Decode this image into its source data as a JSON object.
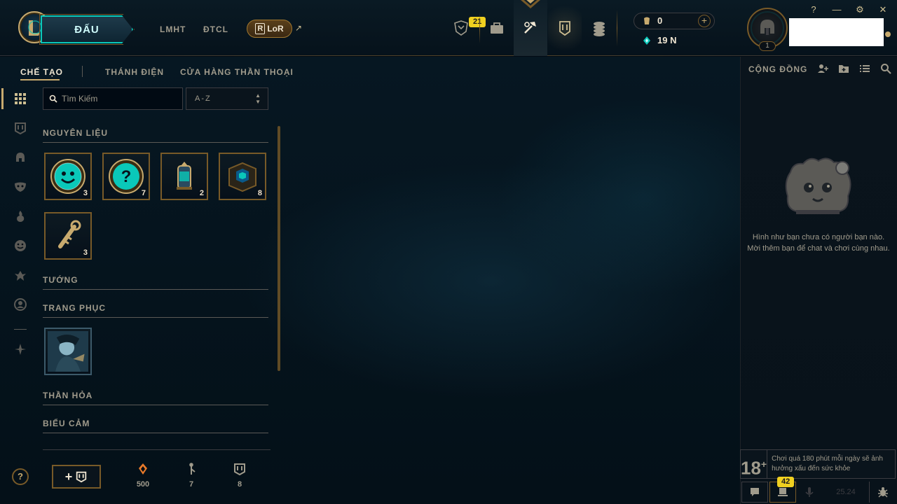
{
  "header": {
    "play_label": "ĐẤU",
    "nav_links": [
      "LMHT",
      "ĐTCL"
    ],
    "lor_label": "LoR",
    "lor_arrow": "↗",
    "missions_badge": "21",
    "currency_rp": "0",
    "currency_be": "19 N",
    "level": "1",
    "window_controls": {
      "help": "?",
      "minimize": "—",
      "settings": "⚙",
      "close": "✕"
    }
  },
  "subnav": {
    "tabs": [
      {
        "label": "CHẾ TẠO",
        "active": true
      },
      {
        "label": "THÁNH ĐIỆN",
        "active": false
      },
      {
        "label": "CỬA HÀNG THẦN THOẠI",
        "active": false
      }
    ]
  },
  "crafting": {
    "search_placeholder": "Tìm Kiếm",
    "sort_value": "A-Z",
    "categories": [
      {
        "label": "NGUYÊN LIỆU"
      },
      {
        "label": "TƯỚNG"
      },
      {
        "label": "TRANG PHỤC"
      },
      {
        "label": "THẦN HỎA"
      },
      {
        "label": "BIỂU CẢM"
      }
    ],
    "materials": [
      {
        "name": "emote-orb",
        "count": "3"
      },
      {
        "name": "mystery-orb",
        "count": "7"
      },
      {
        "name": "capsule",
        "count": "2"
      },
      {
        "name": "hextech-chest",
        "count": "8"
      },
      {
        "name": "key",
        "count": "3"
      }
    ]
  },
  "bottom": {
    "help": "?",
    "add_plus": "+",
    "stats": [
      {
        "icon": "orange-essence-icon",
        "value": "500"
      },
      {
        "icon": "key-fragment-icon",
        "value": "7"
      },
      {
        "icon": "chest-icon",
        "value": "8"
      }
    ]
  },
  "social": {
    "title": "CỘNG ĐỒNG",
    "empty_text": "Hình như bạn chưa có người bạn nào. Mời thêm bạn để chat và chơi cùng nhau.",
    "warning_age": "18",
    "warning_plus": "+",
    "warning_text": "Chơi quá 180 phút mỗi ngày sẽ ảnh hưởng xấu đến sức khỏe",
    "messages_badge": "42",
    "version": "25.24"
  },
  "colors": {
    "gold": "#c8aa6e",
    "gold_dark": "#785a28",
    "teal": "#0ac8b9",
    "text": "#a09b8c",
    "bg": "#010a13"
  }
}
